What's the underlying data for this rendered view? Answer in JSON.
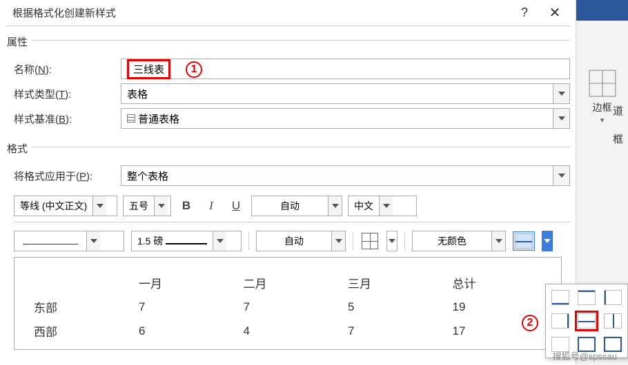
{
  "titlebar": {
    "title": "根据格式化创建新样式",
    "help": "?",
    "close": "✕"
  },
  "sections": {
    "props": "属性",
    "format": "格式"
  },
  "labels": {
    "name": "名称(N):",
    "type": "样式类型(T):",
    "base": "样式基准(B):",
    "apply": "将格式应用于(P):"
  },
  "values": {
    "name": "三线表",
    "type": "表格",
    "base": "普通表格",
    "apply": "整个表格",
    "font": "等线 (中文正文)",
    "size": "五号",
    "color": "自动",
    "lang": "中文",
    "weight": "1.5 磅",
    "pen_color": "自动",
    "fill": "无颜色"
  },
  "callouts": {
    "c1": "1",
    "c2": "2"
  },
  "format_btns": {
    "bold": "B",
    "italic": "I",
    "underline": "U"
  },
  "preview": {
    "headers": [
      "",
      "一月",
      "二月",
      "三月",
      "总计"
    ],
    "rows": [
      [
        "东部",
        "7",
        "7",
        "5",
        "19"
      ],
      [
        "西部",
        "6",
        "4",
        "7",
        "17"
      ]
    ]
  },
  "ribbon": {
    "border_label": "边框",
    "right_cut1": "道",
    "right_cut2": "框"
  },
  "watermark": "搜狐号@spssau"
}
